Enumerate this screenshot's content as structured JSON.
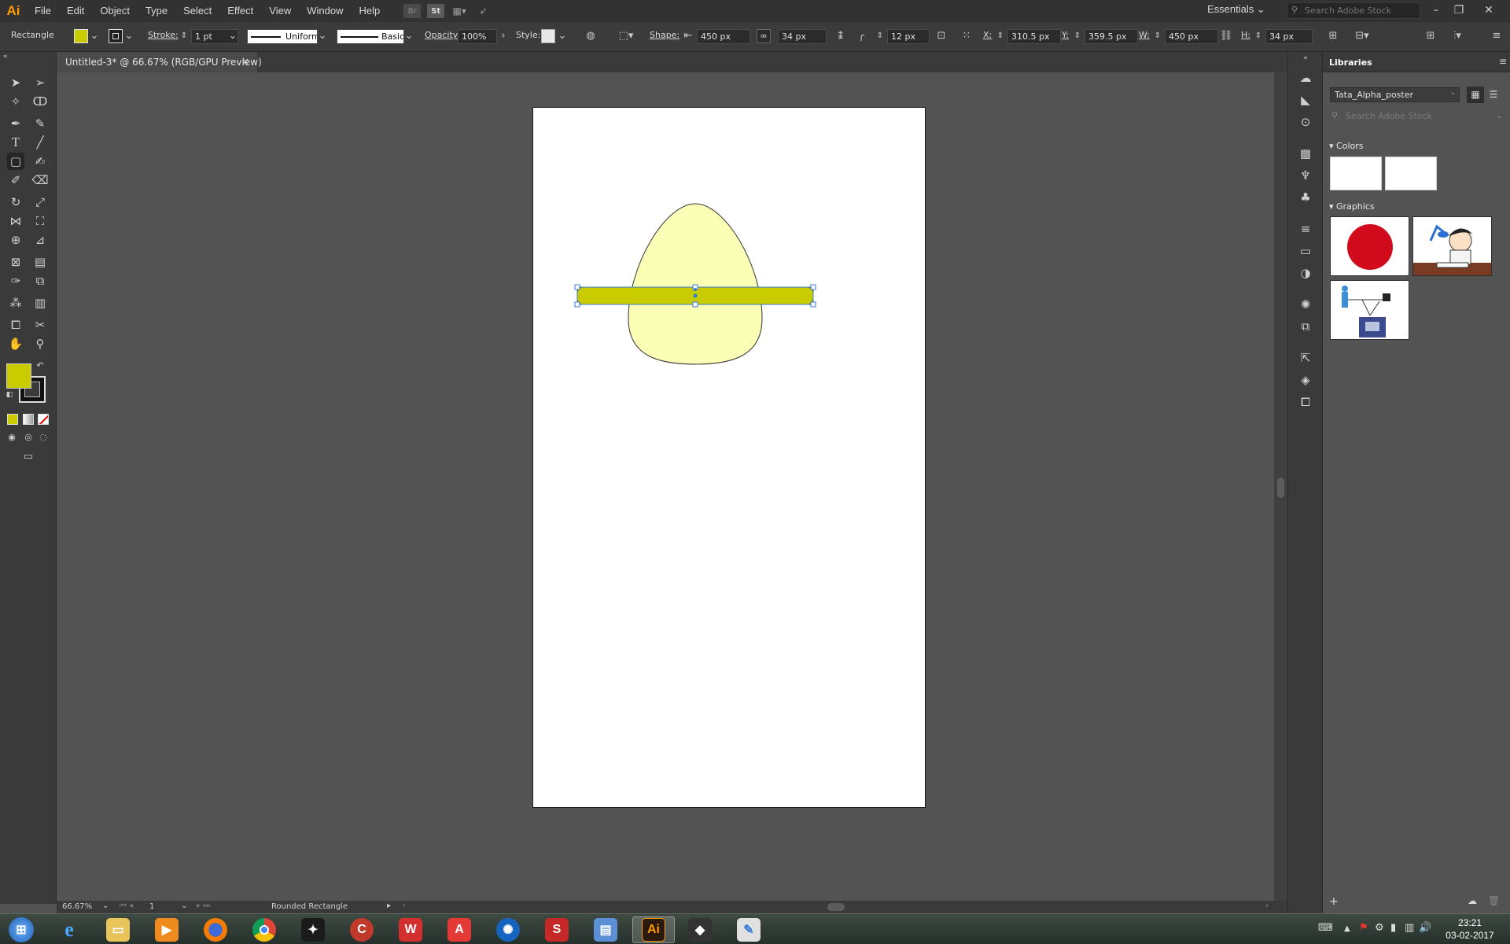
{
  "app": {
    "logo": "Ai"
  },
  "menubar": {
    "items": [
      "File",
      "Edit",
      "Object",
      "Type",
      "Select",
      "Effect",
      "View",
      "Window",
      "Help"
    ],
    "bridge": "Br",
    "stock": "St",
    "workspace": "Essentials",
    "search_placeholder": "Search Adobe Stock",
    "window_buttons": [
      "–",
      "❐",
      "✕"
    ]
  },
  "controlbar": {
    "selection_type": "Rectangle",
    "fill_color": "#c8cc00",
    "stroke_label": "Stroke:",
    "stroke_weight": "1 pt",
    "profile": "Uniform",
    "brush": "Basic",
    "opacity_label": "Opacity:",
    "opacity_value": "100%",
    "style_label": "Style:",
    "shape_label": "Shape:",
    "shape_width": "450 px",
    "shape_height": "34 px",
    "corner_radius": "12 px",
    "x_label": "X:",
    "x_value": "310.5 px",
    "y_label": "Y:",
    "y_value": "359.5 px",
    "w_label": "W:",
    "w_value": "450 px",
    "h_label": "H:",
    "h_value": "34 px"
  },
  "document": {
    "tab_title": "Untitled-3* @ 66.67% (RGB/GPU Preview)",
    "tab_close": "×",
    "egg_color": "#fbffb5",
    "bar_color": "#c8cc00",
    "selection_color": "#3a7bd5"
  },
  "toolbox": {
    "fill_color": "#c8cc00",
    "stroke_color": "#3a3a3a"
  },
  "statusbar": {
    "zoom": "66.67%",
    "artboard": "1",
    "tool_name": "Rounded Rectangle"
  },
  "libraries": {
    "title": "Libraries",
    "library_name": "Tata_Alpha_poster",
    "search_placeholder": "Search Adobe Stock",
    "colors_label": "Colors",
    "graphics_label": "Graphics",
    "swatches": [
      "#ffffff",
      "#ffffff"
    ]
  },
  "taskbar": {
    "time": "23:21",
    "date": "03-02-2017",
    "illustrator_label": "Ai"
  }
}
